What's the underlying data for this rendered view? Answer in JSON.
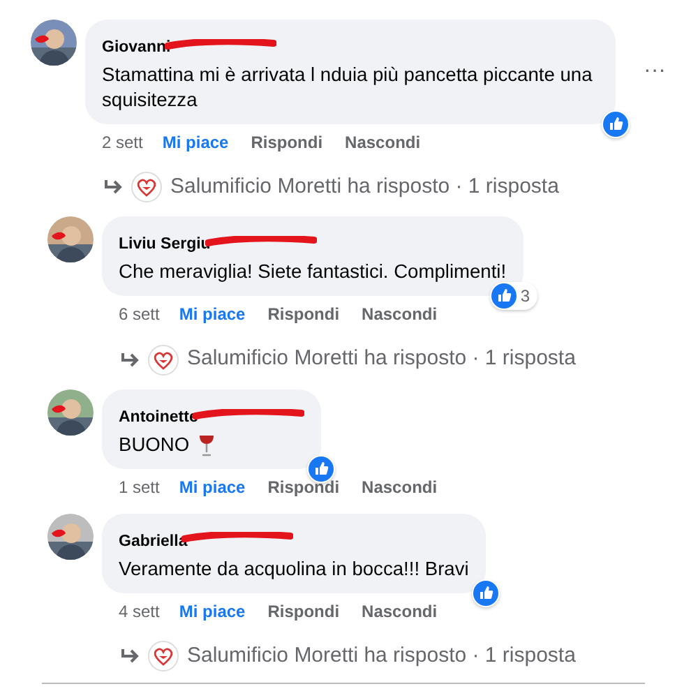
{
  "comments": [
    {
      "author": "Giovanni",
      "text": "Stamattina mi è arrivata l nduia più pancetta piccante una squisitezza",
      "liked": true,
      "time": "2 sett",
      "actions": [
        {
          "label": "Mi piace",
          "selected": true
        },
        {
          "label": "Rispondi",
          "selected": false
        },
        {
          "label": "Nascondi",
          "selected": false
        }
      ],
      "menu": "···",
      "reply_summary": "Salumificio Moretti ha risposto · 1 risposta"
    },
    {
      "author": "Liviu Sergiu",
      "text": "Che meraviglia! Siete fantastici. Complimenti!",
      "liked": true,
      "reaction_count": "3",
      "time": "6 sett",
      "actions": [
        {
          "label": "Mi piace",
          "selected": true
        },
        {
          "label": "Rispondi",
          "selected": false
        },
        {
          "label": "Nascondi",
          "selected": false
        }
      ],
      "reply_summary": "Salumificio Moretti ha risposto · 1 risposta"
    },
    {
      "author": "Antoinette",
      "text": "BUONO",
      "wine_emoji": true,
      "liked": true,
      "time": "1 sett",
      "actions": [
        {
          "label": "Mi piace",
          "selected": true
        },
        {
          "label": "Rispondi",
          "selected": false
        },
        {
          "label": "Nascondi",
          "selected": false
        }
      ]
    },
    {
      "author": "Gabriella",
      "text": "Veramente da acquolina in bocca!!! Bravi",
      "liked": true,
      "time": "4 sett",
      "actions": [
        {
          "label": "Mi piace",
          "selected": true
        },
        {
          "label": "Rispondi",
          "selected": false
        },
        {
          "label": "Nascondi",
          "selected": false
        }
      ],
      "reply_summary": "Salumificio Moretti ha risposto · 1 risposta"
    }
  ]
}
